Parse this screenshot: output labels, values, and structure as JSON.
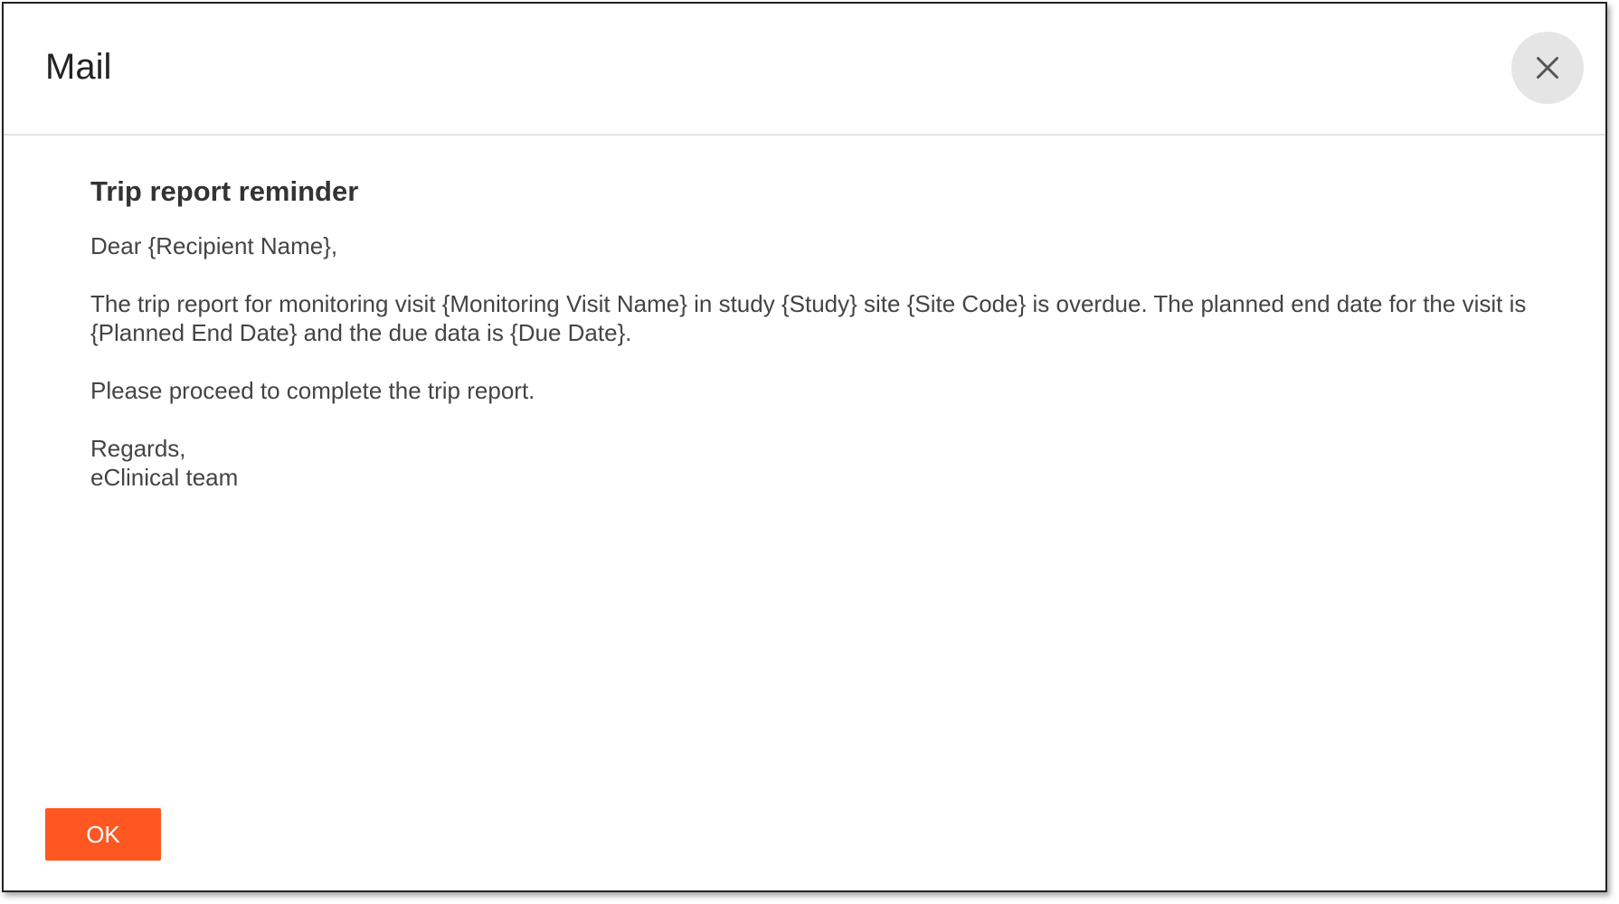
{
  "dialog": {
    "title": "Mail",
    "close_icon": "close-icon",
    "ok_label": "OK"
  },
  "mail": {
    "subject": "Trip report reminder",
    "greeting": "Dear {Recipient Name},",
    "body": "The trip report for monitoring visit {Monitoring Visit Name} in study {Study} site {Site Code} is overdue. The planned end date for the visit is {Planned End Date} and the due data is {Due Date}.",
    "instruction": "Please proceed to complete the trip report.",
    "closing": "Regards,",
    "signature": "eClinical team"
  },
  "colors": {
    "accent": "#ff5722",
    "close_bg": "#e5e5e5",
    "border": "#222222"
  }
}
